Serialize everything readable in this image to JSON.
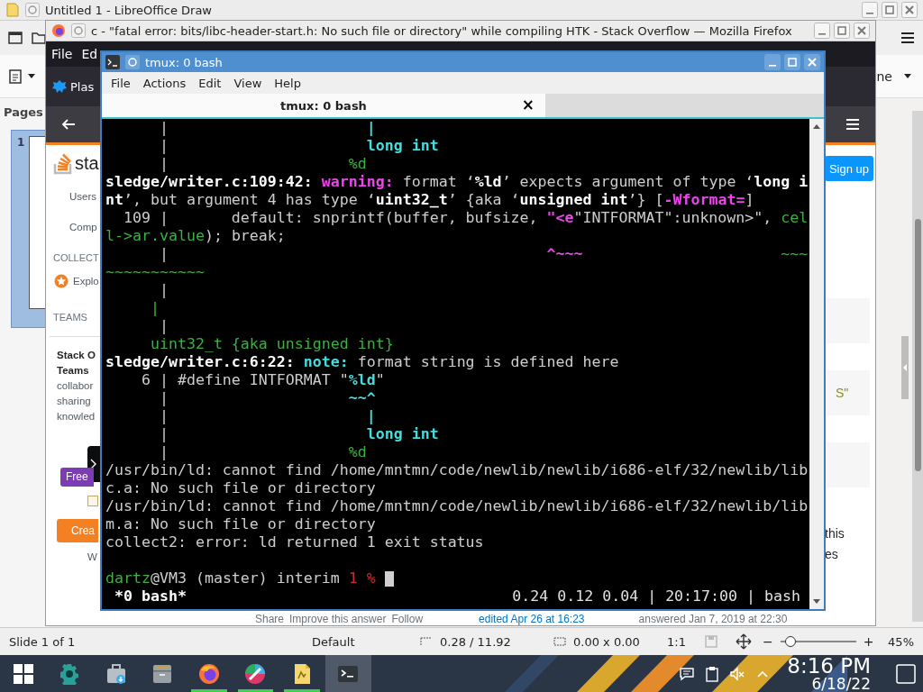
{
  "draw_window": {
    "title": "Untitled 1 - LibreOffice Draw",
    "style_box": "ne",
    "sidebar_title": "Pages",
    "slides": [
      {
        "number": "1",
        "selected": true
      }
    ],
    "status_bar": {
      "slide": "Slide 1 of 1",
      "layout": "Default",
      "position": "0.28 / 11.92",
      "size": "0.00 x 0.00",
      "scale": "1:1",
      "zoom_out": "−",
      "zoom": {
        "level": 0.14
      },
      "zoom_in": "+",
      "zoom_label": "45%"
    }
  },
  "browser_window": {
    "title": "c - \"fatal error: bits/libc-header-start.h: No such file or directory\" while compiling HTK - Stack Overflow — Mozilla Firefox",
    "menu": [
      "File",
      "Ed"
    ],
    "bookmarks": [
      "Plas"
    ],
    "page": {
      "logo_text": "sta",
      "nav": [
        "Users",
        "Comp"
      ],
      "collectives_heading": "COLLECT",
      "collectives_link": "Explo",
      "teams_heading": "TEAMS",
      "teams_title": "Stack O",
      "teams_subtitle": "Teams",
      "teams_text": [
        "collabor",
        "sharing",
        "knowled"
      ],
      "free_badge": "Free",
      "checkbox": {
        "checked": false
      },
      "create_button": "Crea",
      "teams_link": "W",
      "signup_button": "Sign up",
      "code_fragment": "S\"",
      "answer_text": [
        "this",
        "es"
      ],
      "post_actions": [
        "Share",
        "Improve this answer",
        "Follow"
      ],
      "edited": "edited Apr 26 at 16:23",
      "answered": "answered Jan 7, 2019 at 22:30"
    }
  },
  "terminal_window": {
    "title": "tmux: 0 bash",
    "menu": [
      "File",
      "Actions",
      "Edit",
      "View",
      "Help"
    ],
    "tab": {
      "label": "tmux: 0 bash",
      "close": "×"
    },
    "lines": [
      [
        {
          "text": "      |                      ",
          "kind": "plain"
        },
        {
          "text": "|",
          "kind": "cyan"
        }
      ],
      [
        {
          "text": "      |                      ",
          "kind": "plain"
        },
        {
          "text": "long int",
          "kind": "cyan"
        }
      ],
      [
        {
          "text": "      |                    ",
          "kind": "plain"
        },
        {
          "text": "%d",
          "kind": "green"
        }
      ],
      [
        {
          "text": "sledge/writer.c:109:42: ",
          "kind": "bold"
        },
        {
          "text": "warning:",
          "kind": "magenta"
        },
        {
          "text": " format ‘",
          "kind": "plain"
        },
        {
          "text": "%ld",
          "kind": "bold"
        },
        {
          "text": "’ expects argument of type ‘",
          "kind": "plain"
        },
        {
          "text": "long i",
          "kind": "bold"
        }
      ],
      [
        {
          "text": "nt",
          "kind": "bold"
        },
        {
          "text": "’, but argument 4 has type ‘",
          "kind": "plain"
        },
        {
          "text": "uint32_t",
          "kind": "bold"
        },
        {
          "text": "’ {aka ‘",
          "kind": "plain"
        },
        {
          "text": "unsigned int",
          "kind": "bold"
        },
        {
          "text": "’} [",
          "kind": "plain"
        },
        {
          "text": "-Wformat=",
          "kind": "magenta"
        },
        {
          "text": "]",
          "kind": "plain"
        }
      ],
      [
        {
          "text": "  109 |       default: snprintf(buffer, bufsize, ",
          "kind": "plain"
        },
        {
          "text": "\"<e",
          "kind": "magenta"
        },
        {
          "text": "\"INTFORMAT\":unknown>\", ",
          "kind": "plain"
        },
        {
          "text": "cel",
          "kind": "green"
        }
      ],
      [
        {
          "text": "l->ar.value",
          "kind": "green"
        },
        {
          "text": "); break;",
          "kind": "plain"
        }
      ],
      [
        {
          "text": "      |                                          ",
          "kind": "plain"
        },
        {
          "text": "^~~~",
          "kind": "magenta"
        },
        {
          "text": "                      ~~~",
          "kind": "green"
        }
      ],
      [
        {
          "text": "~~~~~~~~~~~",
          "kind": "green"
        }
      ],
      [
        {
          "text": "      |",
          "kind": "plain"
        }
      ],
      [
        {
          "text": "     |",
          "kind": "green"
        }
      ],
      [
        {
          "text": "      |",
          "kind": "plain"
        }
      ],
      [
        {
          "text": "     uint32_t {aka unsigned int}",
          "kind": "green"
        }
      ],
      [
        {
          "text": "sledge/writer.c:6:22: ",
          "kind": "bold"
        },
        {
          "text": "note:",
          "kind": "cyan"
        },
        {
          "text": " format string is defined here",
          "kind": "plain"
        }
      ],
      [
        {
          "text": "    6 | #define INTFORMAT \"",
          "kind": "plain"
        },
        {
          "text": "%ld",
          "kind": "cyan"
        },
        {
          "text": "\"",
          "kind": "plain"
        }
      ],
      [
        {
          "text": "      |                    ",
          "kind": "plain"
        },
        {
          "text": "~~^",
          "kind": "cyan"
        }
      ],
      [
        {
          "text": "      |                      ",
          "kind": "plain"
        },
        {
          "text": "|",
          "kind": "cyan"
        }
      ],
      [
        {
          "text": "      |                      ",
          "kind": "plain"
        },
        {
          "text": "long int",
          "kind": "cyan"
        }
      ],
      [
        {
          "text": "      |                    ",
          "kind": "plain"
        },
        {
          "text": "%d",
          "kind": "green"
        }
      ],
      [
        {
          "text": "/usr/bin/ld: cannot find /home/mntmn/code/newlib/newlib/i686-elf/32/newlib/lib",
          "kind": "plain"
        }
      ],
      [
        {
          "text": "c.a: No such file or directory",
          "kind": "plain"
        }
      ],
      [
        {
          "text": "/usr/bin/ld: cannot find /home/mntmn/code/newlib/newlib/i686-elf/32/newlib/lib",
          "kind": "plain"
        }
      ],
      [
        {
          "text": "m.a: No such file or directory",
          "kind": "plain"
        }
      ],
      [
        {
          "text": "collect2: error: ld returned 1 exit status",
          "kind": "plain"
        }
      ]
    ],
    "prompt": {
      "segments": [
        {
          "text": "dartz",
          "kind": "green"
        },
        {
          "text": "@VM3 (master) interim ",
          "kind": "plain"
        },
        {
          "text": "1 %",
          "kind": "red"
        }
      ],
      "cursor": true
    },
    "status_left": "*0 bash*",
    "status_right": "0.24 0.12 0.04 | 20:17:00 | bash"
  },
  "taskbar": {
    "apps": [
      {
        "kind": "start",
        "running": false,
        "active": false
      },
      {
        "kind": "settings",
        "running": false,
        "active": false
      },
      {
        "kind": "package",
        "running": false,
        "active": false
      },
      {
        "kind": "files",
        "running": false,
        "active": false
      },
      {
        "kind": "browser",
        "running": true,
        "active": false
      },
      {
        "kind": "paint",
        "running": true,
        "active": false
      },
      {
        "kind": "draw",
        "running": true,
        "active": false
      },
      {
        "kind": "terminal",
        "running": false,
        "active": true
      }
    ],
    "clock": {
      "time": "8:16 PM",
      "date": "6/18/22"
    }
  }
}
